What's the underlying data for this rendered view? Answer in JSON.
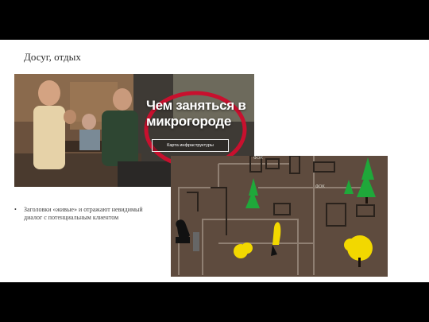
{
  "slide": {
    "title": "Досуг, отдых",
    "bullets": [
      "Заголовки «живые» и отражают невидимый диалог с потенциальным клиентом"
    ],
    "bullet_glyph": "•"
  },
  "promo": {
    "headline": "Чем заняться в микрогороде",
    "button_label": "Карта инфраструктуры"
  },
  "map": {
    "labels": [
      "ФОК",
      "ФОК"
    ]
  },
  "colors": {
    "slide_background": "#ffffff",
    "frame": "#000000",
    "highlight_ellipse": "#c8102e",
    "map_ground": "#5e4b3e",
    "tree_yellow": "#f2d800",
    "tree_green": "#1fa83a"
  }
}
